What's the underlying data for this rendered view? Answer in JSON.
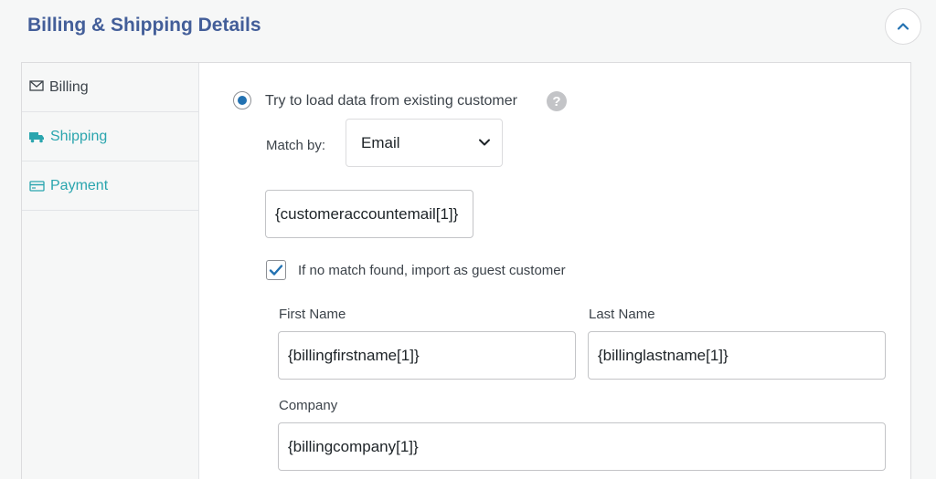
{
  "header": {
    "title": "Billing & Shipping Details"
  },
  "sidebar": {
    "items": [
      {
        "label": "Billing",
        "icon": "envelope-icon"
      },
      {
        "label": "Shipping",
        "icon": "truck-icon"
      },
      {
        "label": "Payment",
        "icon": "credit-card-icon"
      }
    ]
  },
  "form": {
    "load_option_label": "Try to load data from existing customer",
    "match_by_label": "Match by:",
    "match_by_value": "Email",
    "email_value": "{customeraccountemail[1]}",
    "guest_label": "If no match found, import as guest customer",
    "first_name_label": "First Name",
    "first_name_value": "{billingfirstname[1]}",
    "last_name_label": "Last Name",
    "last_name_value": "{billinglastname[1]}",
    "company_label": "Company",
    "company_value": "{billingcompany[1]}"
  },
  "colors": {
    "accent": "#2271b1",
    "title": "#435e99",
    "link": "#2aa5ae"
  }
}
